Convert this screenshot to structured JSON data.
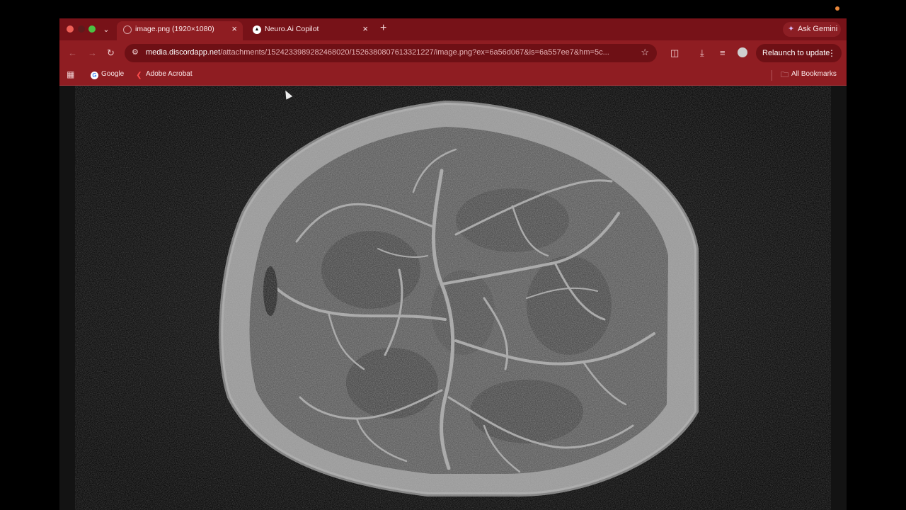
{
  "tabs": [
    {
      "title": "image.png (1920×1080)",
      "active": true
    },
    {
      "title": "Neuro.Ai Copilot",
      "active": false
    }
  ],
  "ask_gemini": "Ask Gemini",
  "address": {
    "host": "media.discordapp.net",
    "path": "/attachments/1524233989282468020/1526380807613321227/image.png?ex=6a56d067&is=6a557ee7&hm=5c..."
  },
  "relaunch": "Relaunch to update",
  "bookmarks": {
    "items": [
      "Google",
      "Adobe Acrobat"
    ],
    "all": "All Bookmarks"
  },
  "icons": {
    "back": "back-arrow-icon",
    "forward": "forward-arrow-icon",
    "reload": "reload-icon",
    "site_settings": "tune-icon",
    "bookmark_star": "star-icon",
    "extensions": "puzzle-icon",
    "downloads": "download-icon",
    "reading_list": "reading-list-icon",
    "apps": "apps-grid-icon"
  },
  "colors": {
    "frame": "#771218",
    "toolbar": "#8f1d22",
    "omnibox": "#6e1015",
    "page_bg": "#131313"
  },
  "image_content": "grayscale noisy axial brain scan with bright vessel network"
}
